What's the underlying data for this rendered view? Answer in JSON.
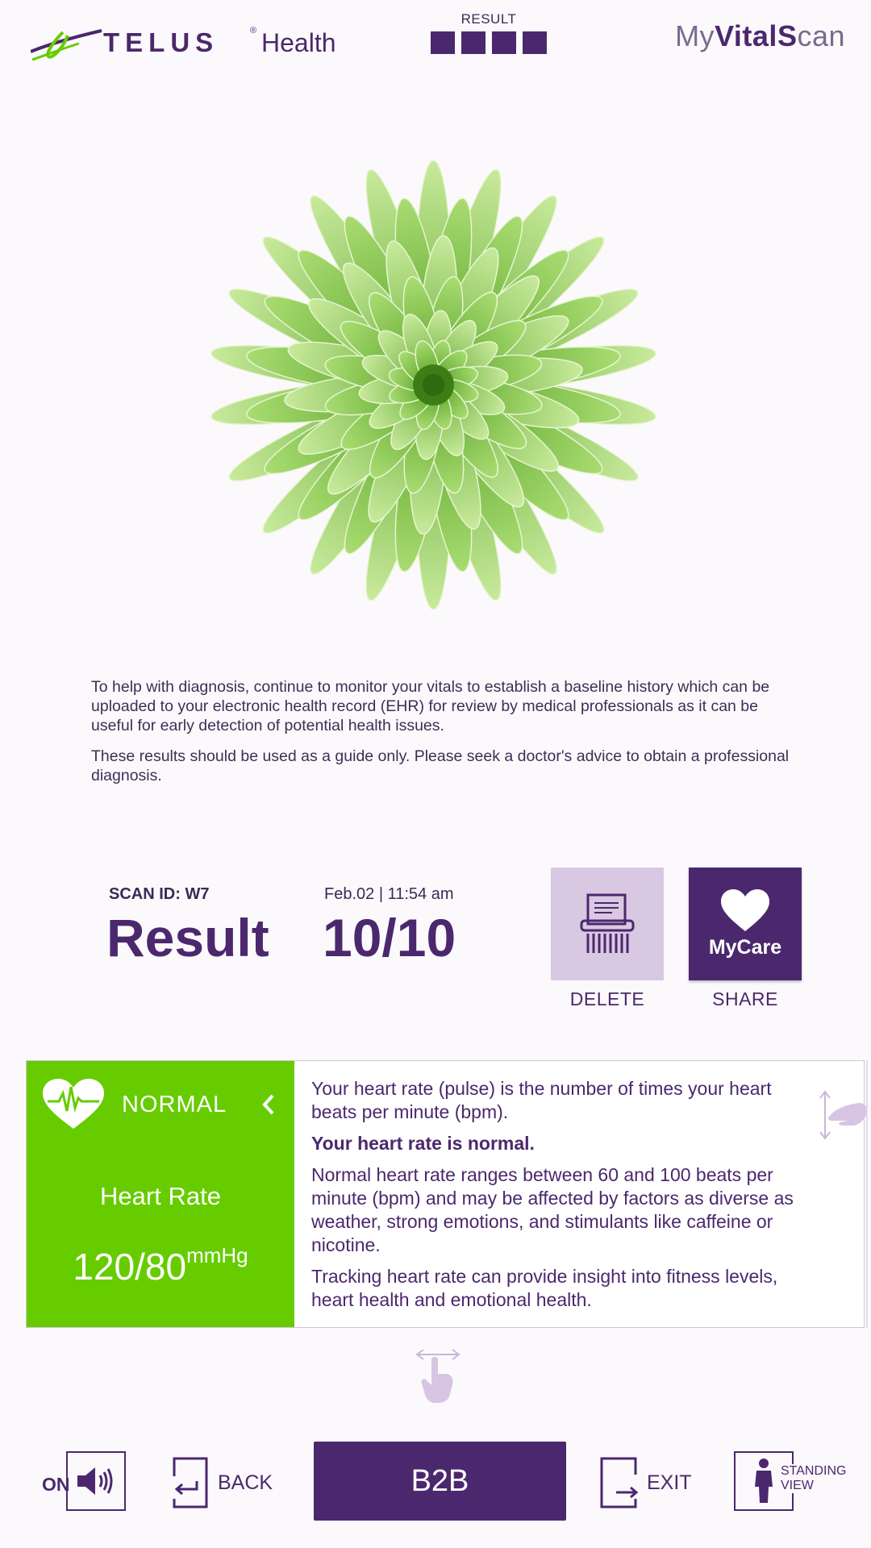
{
  "header": {
    "brand_name": "TELUS",
    "brand_suffix": "Health",
    "brand_mark": "®",
    "progress_label": "RESULT",
    "progress_steps_total": 4,
    "progress_steps_done": 4,
    "app_title_pre": "My",
    "app_title_bold": "VitalS",
    "app_title_post": "can"
  },
  "hero": {
    "image": "green-chrysanthemum-flower"
  },
  "info": {
    "paragraph_1": "To help with diagnosis, continue to monitor your vitals to establish a baseline history which can be uploaded to your electronic health record (EHR) for review by medical professionals as it can be useful for early detection of potential health issues.",
    "paragraph_2": "These results should be used as a guide only. Please seek a doctor's advice to obtain a professional diagnosis."
  },
  "result": {
    "scan_id": "SCAN ID: W7",
    "title": "Result",
    "date": "Feb.02 | 11:54 am",
    "score": "10/10",
    "delete_label": "DELETE",
    "share_label": "SHARE",
    "mycare_label": "MyCare"
  },
  "card": {
    "status": "NORMAL",
    "metric_name": "Heart Rate",
    "metric_value": "120/80",
    "metric_unit": "mmHg",
    "text_1": "Your heart rate (pulse) is the number of times your heart beats per minute (bpm).",
    "text_2": "Your heart rate is normal.",
    "text_3": "Normal heart rate ranges between 60 and 100 beats per minute (bpm) and may be affected by factors as diverse as weather, strong emotions, and stimulants like caffeine or nicotine.",
    "text_4": "Tracking heart rate can provide insight into fitness levels, heart health and emotional health.",
    "status_color": "#66cc00"
  },
  "footer": {
    "sound_label": "ON",
    "back_label": "BACK",
    "primary_label": "B2B",
    "exit_label": "EXIT",
    "standing_line1": "STANDING",
    "standing_line2": "VIEW"
  },
  "colors": {
    "brand_purple": "#4b286d",
    "brand_green": "#66cc00",
    "light_purple": "#d9c8e2",
    "background": "#fcf9fd"
  },
  "icons": [
    "telus-swoosh-icon",
    "delete-shredder-icon",
    "mycare-heart-icon",
    "heart-pulse-icon",
    "chevron-left-icon",
    "swipe-side-icon",
    "swipe-down-icon",
    "speaker-icon",
    "back-icon",
    "exit-icon",
    "standing-person-icon"
  ]
}
